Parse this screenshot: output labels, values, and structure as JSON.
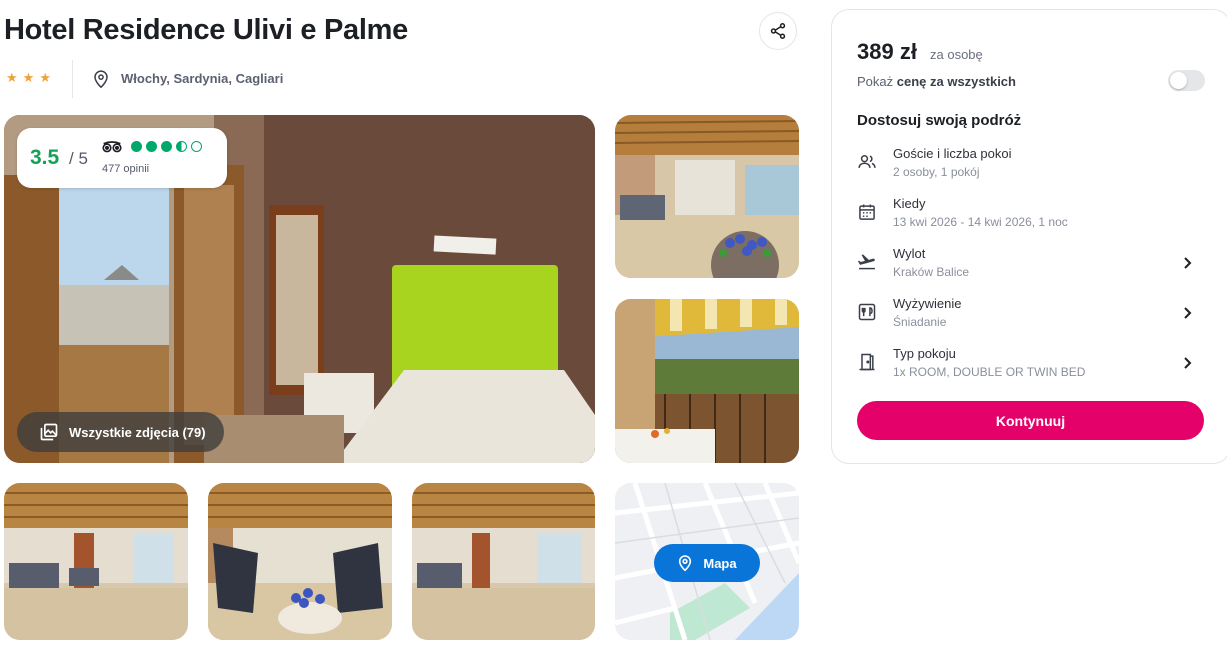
{
  "hotel": {
    "name": "Hotel Residence Ulivi e Palme",
    "stars": 3,
    "location": "Włochy, Sardynia, Cagliari"
  },
  "rating": {
    "score": "3.5",
    "max": "/ 5",
    "bubbles": 3.5,
    "reviews": "477 opinii"
  },
  "gallery": {
    "all_photos_label": "Wszystkie zdjęcia (79)",
    "map_label": "Mapa"
  },
  "booking": {
    "price": "389 zł",
    "price_unit": "za osobę",
    "show_all_prefix": "Pokaż ",
    "show_all_bold": "cenę za wszystkich",
    "toggle_on": false,
    "section_title": "Dostosuj swoją podróż",
    "options": [
      {
        "label": "Goście i liczba pokoi",
        "value": "2 osoby, 1 pokój",
        "icon": "guests-icon",
        "chevron": false
      },
      {
        "label": "Kiedy",
        "value": "13 kwi 2026 - 14 kwi 2026, 1 noc",
        "icon": "calendar-icon",
        "chevron": false
      },
      {
        "label": "Wylot",
        "value": "Kraków Balice",
        "icon": "plane-departure-icon",
        "chevron": true
      },
      {
        "label": "Wyżywienie",
        "value": "Śniadanie",
        "icon": "meal-icon",
        "chevron": true
      },
      {
        "label": "Typ pokoju",
        "value": "1x ROOM, DOUBLE OR TWIN BED",
        "icon": "room-door-icon",
        "chevron": true
      }
    ],
    "cta_label": "Kontynuuj"
  },
  "colors": {
    "accent": "#e5016a",
    "rating_green": "#18a058",
    "star": "#f0a235",
    "map_button": "#0a75d9"
  }
}
